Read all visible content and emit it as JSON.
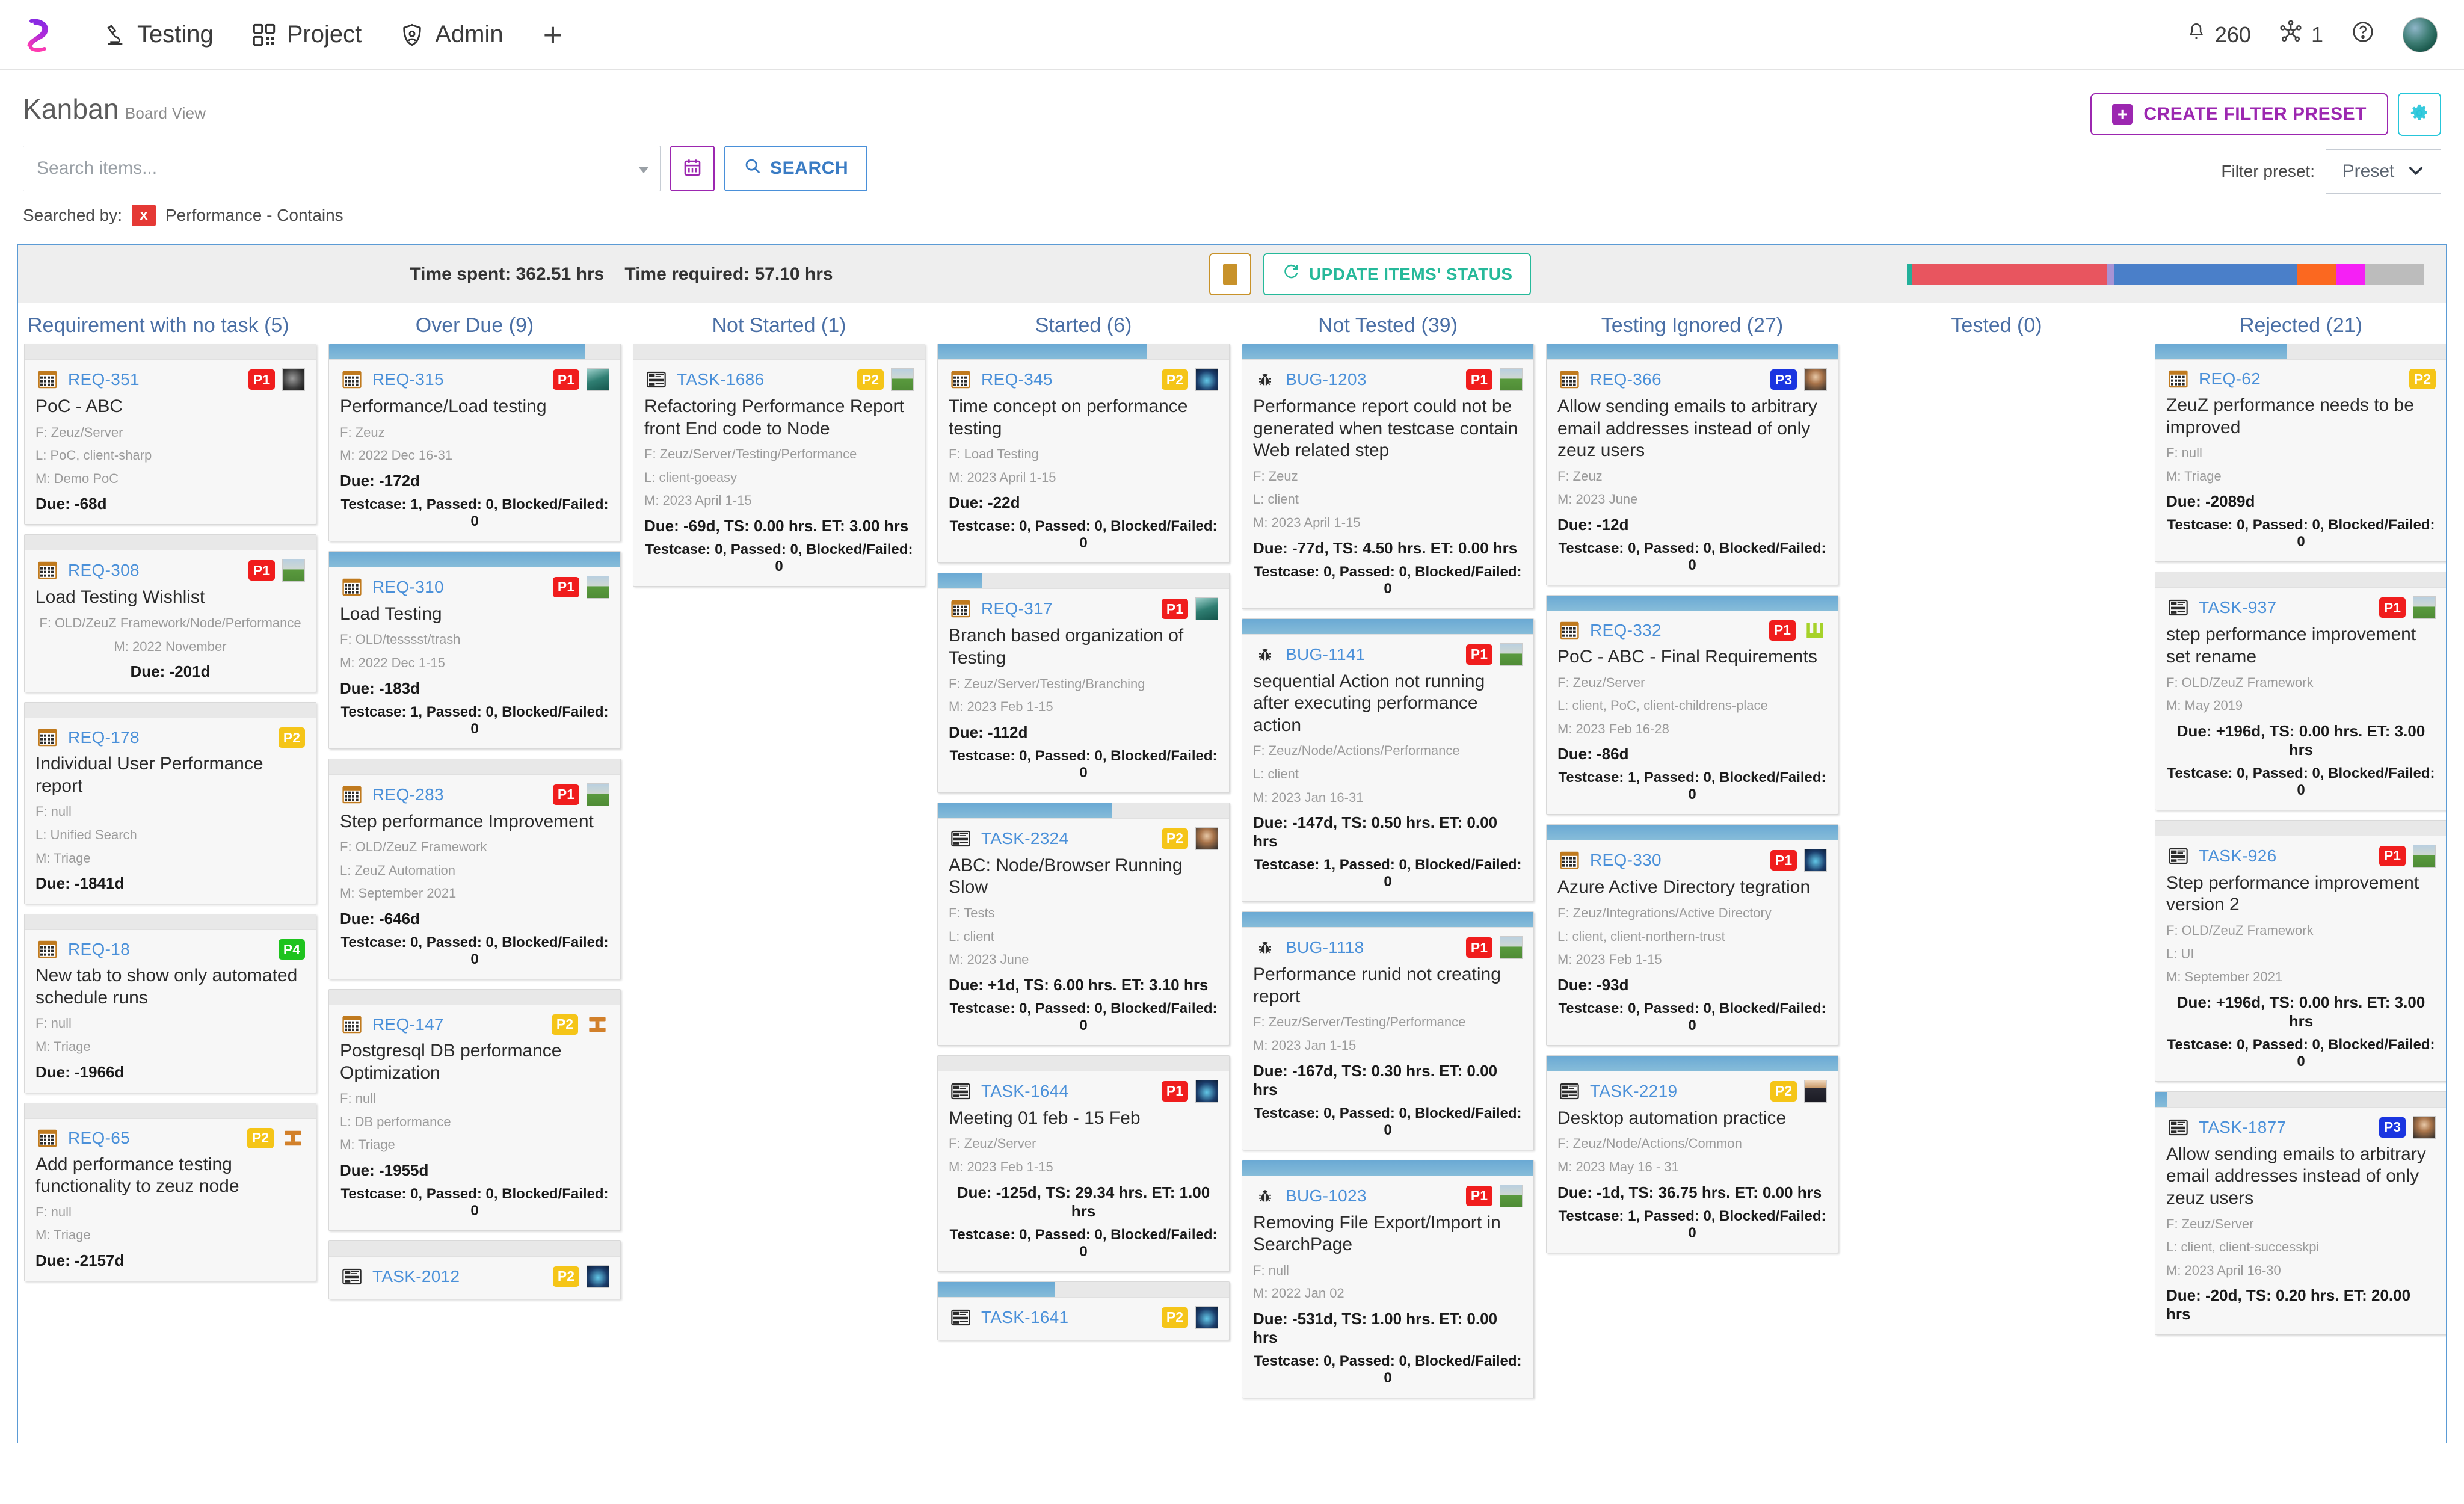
{
  "topnav": {
    "logo": "zeuz-logo",
    "items": [
      {
        "label": "Testing",
        "icon": "microscope-icon"
      },
      {
        "label": "Project",
        "icon": "grid-icon"
      },
      {
        "label": "Admin",
        "icon": "shield-user-icon"
      }
    ],
    "add_label": "+",
    "notifications_count": "260",
    "nodes_count": "1",
    "help_icon": "question-circle-icon",
    "avatar": "user-avatar"
  },
  "page": {
    "title": "Kanban",
    "subtitle": "Board View"
  },
  "search": {
    "placeholder": "Search items...",
    "value": "",
    "calendar_icon": "calendar-icon",
    "search_button": "SEARCH",
    "searched_by_label": "Searched by:",
    "chip_close": "x",
    "chip_text": "Performance - Contains"
  },
  "filters": {
    "create_preset": "CREATE FILTER PRESET",
    "gear_icon": "gear-icon",
    "preset_label": "Filter preset:",
    "preset_value": "Preset"
  },
  "stats": {
    "time_spent": "Time spent: 362.51 hrs",
    "time_required": "Time required: 57.10 hrs",
    "card_view_icon": "card-view-icon",
    "update_button": "UPDATE ITEMS' STATUS",
    "legend_segments": [
      {
        "color": "#22b09a",
        "pct": 1.1
      },
      {
        "color": "#e8555f",
        "pct": 37.5
      },
      {
        "color": "#a893d4",
        "pct": 1.4
      },
      {
        "color": "#4a7fc9",
        "pct": 35.5
      },
      {
        "color": "#fb6820",
        "pct": 7.5
      },
      {
        "color": "#f520f5",
        "pct": 5.5
      },
      {
        "color": "#bcbcbc",
        "pct": 11.5
      }
    ]
  },
  "columns": [
    {
      "title": "Requirement with no task  (5)",
      "cards": [
        {
          "type": "req",
          "id": "REQ-351",
          "bar": 0,
          "title": "PoC - ABC",
          "meta": [
            "F: Zeuz/Server",
            "L: PoC, client-sharp",
            "M: Demo PoC"
          ],
          "due": "Due: -68d",
          "tc": "",
          "priority": "P1",
          "thumb": "th-dark",
          "due_align": "left",
          "meta_align": "left"
        },
        {
          "type": "req",
          "id": "REQ-308",
          "bar": 0,
          "title": "Load Testing Wishlist",
          "meta": [
            "F: OLD/ZeuZ Framework/Node/Performance",
            "M: 2022 November"
          ],
          "due": "Due: -201d",
          "tc": "",
          "priority": "P1",
          "thumb": "th-field",
          "due_align": "center",
          "meta_align": "center"
        },
        {
          "type": "req",
          "id": "REQ-178",
          "bar": 0,
          "title": "Individual User Performance report",
          "meta": [
            "F: null",
            "L: Unified Search",
            "M: Triage"
          ],
          "due": "Due: -1841d",
          "tc": "",
          "priority": "P2",
          "thumb": "",
          "due_align": "left",
          "meta_align": "left"
        },
        {
          "type": "req",
          "id": "REQ-18",
          "bar": 0,
          "title": "New tab to show only automated schedule runs",
          "meta": [
            "F: null",
            "M: Triage"
          ],
          "due": "Due: -1966d",
          "tc": "",
          "priority": "P4",
          "thumb": "",
          "due_align": "left",
          "meta_align": "left"
        },
        {
          "type": "req",
          "id": "REQ-65",
          "bar": 0,
          "title": "Add performance testing functionality to zeuz node",
          "meta": [
            "F: null",
            "M: Triage"
          ],
          "due": "Due: -2157d",
          "tc": "",
          "priority": "P2",
          "thumb": "construct",
          "due_align": "left",
          "meta_align": "left"
        }
      ]
    },
    {
      "title": "Over Due  (9)",
      "cards": [
        {
          "type": "req",
          "id": "REQ-315",
          "bar": 88,
          "title": "Performance/Load testing",
          "meta": [
            "F: Zeuz",
            "M: 2022 Dec 16-31"
          ],
          "due": "Due: -172d",
          "tc": "Testcase: 1, Passed: 0, Blocked/Failed: 0",
          "priority": "P1",
          "thumb": "th-green",
          "due_align": "left",
          "meta_align": "left"
        },
        {
          "type": "req",
          "id": "REQ-310",
          "bar": 100,
          "title": "Load Testing",
          "meta": [
            "F: OLD/tesssst/trash",
            "M: 2022 Dec 1-15"
          ],
          "due": "Due: -183d",
          "tc": "Testcase: 1, Passed: 0, Blocked/Failed: 0",
          "priority": "P1",
          "thumb": "th-field",
          "due_align": "left",
          "meta_align": "left"
        },
        {
          "type": "req",
          "id": "REQ-283",
          "bar": 0,
          "title": "Step performance Improvement",
          "meta": [
            "F: OLD/ZeuZ Framework",
            "L: ZeuZ Automation",
            "M: September 2021"
          ],
          "due": "Due: -646d",
          "tc": "Testcase: 0, Passed: 0, Blocked/Failed: 0",
          "priority": "P1",
          "thumb": "th-field",
          "due_align": "left",
          "meta_align": "left"
        },
        {
          "type": "req",
          "id": "REQ-147",
          "bar": 0,
          "title": "Postgresql DB performance Optimization",
          "meta": [
            "F: null",
            "L: DB performance",
            "M: Triage"
          ],
          "due": "Due: -1955d",
          "tc": "Testcase: 0, Passed: 0, Blocked/Failed: 0",
          "priority": "P2",
          "thumb": "construct",
          "due_align": "left",
          "meta_align": "left"
        },
        {
          "type": "task",
          "id": "TASK-2012",
          "bar": 0,
          "title": "",
          "meta": [],
          "due": "",
          "tc": "",
          "priority": "P2",
          "thumb": "th-blue",
          "due_align": "left",
          "meta_align": "left"
        }
      ]
    },
    {
      "title": "Not Started  (1)",
      "cards": [
        {
          "type": "task",
          "id": "TASK-1686",
          "bar": 0,
          "title": "Refactoring Performance Report front End code to Node",
          "meta": [
            "F: Zeuz/Server/Testing/Performance",
            "L: client-goeasy",
            "M: 2023 April 1-15"
          ],
          "due": "Due: -69d, TS: 0.00 hrs. ET: 3.00 hrs",
          "tc": "Testcase: 0, Passed: 0, Blocked/Failed: 0",
          "priority": "P2",
          "thumb": "th-field",
          "due_align": "left",
          "meta_align": "left"
        }
      ]
    },
    {
      "title": "Started  (6)",
      "cards": [
        {
          "type": "req",
          "id": "REQ-345",
          "bar": 72,
          "title": "Time concept on performance testing",
          "meta": [
            "F: Load Testing",
            "M: 2023 April 1-15"
          ],
          "due": "Due: -22d",
          "tc": "Testcase: 0, Passed: 0, Blocked/Failed: 0",
          "priority": "P2",
          "thumb": "th-blue",
          "due_align": "left",
          "meta_align": "left"
        },
        {
          "type": "req",
          "id": "REQ-317",
          "bar": 15,
          "title": "Branch based organization of Testing",
          "meta": [
            "F: Zeuz/Server/Testing/Branching",
            "M: 2023 Feb 1-15"
          ],
          "due": "Due: -112d",
          "tc": "Testcase: 0, Passed: 0, Blocked/Failed: 0",
          "priority": "P1",
          "thumb": "th-green",
          "due_align": "left",
          "meta_align": "left"
        },
        {
          "type": "task",
          "id": "TASK-2324",
          "bar": 60,
          "title": "ABC: Node/Browser Running Slow",
          "meta": [
            "F: Tests",
            "L: client",
            "M: 2023 June"
          ],
          "due": "Due: +1d, TS: 6.00 hrs. ET: 3.10 hrs",
          "tc": "Testcase: 0, Passed: 0, Blocked/Failed: 0",
          "priority": "P2",
          "thumb": "th-person",
          "due_align": "left",
          "meta_align": "left"
        },
        {
          "type": "task",
          "id": "TASK-1644",
          "bar": 0,
          "title": "Meeting 01 feb - 15 Feb",
          "meta": [
            "F: Zeuz/Server",
            "M: 2023 Feb 1-15"
          ],
          "due": "Due: -125d, TS: 29.34 hrs. ET: 1.00 hrs",
          "tc": "Testcase: 0, Passed: 0, Blocked/Failed: 0",
          "priority": "P1",
          "thumb": "th-blue",
          "due_align": "center",
          "meta_align": "left"
        },
        {
          "type": "task",
          "id": "TASK-1641",
          "bar": 40,
          "title": "",
          "meta": [],
          "due": "",
          "tc": "",
          "priority": "P2",
          "thumb": "th-blue",
          "due_align": "left",
          "meta_align": "left"
        }
      ]
    },
    {
      "title": "Not Tested  (39)",
      "cards": [
        {
          "type": "bug",
          "id": "BUG-1203",
          "bar": 100,
          "title": "Performance report could not be generated when testcase contain Web related step",
          "meta": [
            "F: Zeuz",
            "L: client",
            "M: 2023 April 1-15"
          ],
          "due": "Due: -77d, TS: 4.50 hrs. ET: 0.00 hrs",
          "tc": "Testcase: 0, Passed: 0, Blocked/Failed: 0",
          "priority": "P1",
          "thumb": "th-field",
          "due_align": "left",
          "meta_align": "left"
        },
        {
          "type": "bug",
          "id": "BUG-1141",
          "bar": 100,
          "title": "sequential Action not running after executing performance action",
          "meta": [
            "F: Zeuz/Node/Actions/Performance",
            "L: client",
            "M: 2023 Jan 16-31"
          ],
          "due": "Due: -147d, TS: 0.50 hrs. ET: 0.00 hrs",
          "tc": "Testcase: 1, Passed: 0, Blocked/Failed: 0",
          "priority": "P1",
          "thumb": "th-field",
          "due_align": "left",
          "meta_align": "left"
        },
        {
          "type": "bug",
          "id": "BUG-1118",
          "bar": 100,
          "title": "Performance runid not creating report",
          "meta": [
            "F: Zeuz/Server/Testing/Performance",
            "M: 2023 Jan 1-15"
          ],
          "due": "Due: -167d, TS: 0.30 hrs. ET: 0.00 hrs",
          "tc": "Testcase: 0, Passed: 0, Blocked/Failed: 0",
          "priority": "P1",
          "thumb": "th-field",
          "due_align": "left",
          "meta_align": "left"
        },
        {
          "type": "bug",
          "id": "BUG-1023",
          "bar": 100,
          "title": "Removing File Export/Import in SearchPage",
          "meta": [
            "F: null",
            "M: 2022 Jan 02"
          ],
          "due": "Due: -531d, TS: 1.00 hrs. ET: 0.00 hrs",
          "tc": "Testcase: 0, Passed: 0, Blocked/Failed: 0",
          "priority": "P1",
          "thumb": "th-field",
          "due_align": "left",
          "meta_align": "left"
        }
      ]
    },
    {
      "title": "Testing Ignored  (27)",
      "cards": [
        {
          "type": "req",
          "id": "REQ-366",
          "bar": 100,
          "title": "Allow sending emails to arbitrary email addresses instead of only zeuz users",
          "meta": [
            "F: Zeuz",
            "M: 2023 June"
          ],
          "due": "Due: -12d",
          "tc": "Testcase: 0, Passed: 0, Blocked/Failed: 0",
          "priority": "P3",
          "thumb": "th-person",
          "due_align": "left",
          "meta_align": "left"
        },
        {
          "type": "req",
          "id": "REQ-332",
          "bar": 100,
          "title": "PoC - ABC - Final Requirements",
          "meta": [
            "F: Zeuz/Server",
            "L: client, PoC, client-childrens-place",
            "M: 2023 Feb 16-28"
          ],
          "due": "Due: -86d",
          "tc": "Testcase: 1, Passed: 0, Blocked/Failed: 0",
          "priority": "P1",
          "thumb": "th-ui",
          "due_align": "left",
          "meta_align": "left"
        },
        {
          "type": "req",
          "id": "REQ-330",
          "bar": 100,
          "title": "Azure Active Directory tegration",
          "meta": [
            "F: Zeuz/Integrations/Active Directory",
            "L: client, client-northern-trust",
            "M: 2023 Feb 1-15"
          ],
          "due": "Due: -93d",
          "tc": "Testcase: 0, Passed: 0, Blocked/Failed: 0",
          "priority": "P1",
          "thumb": "th-blue",
          "due_align": "left",
          "meta_align": "left"
        },
        {
          "type": "task",
          "id": "TASK-2219",
          "bar": 100,
          "title": "Desktop automation practice",
          "meta": [
            "F: Zeuz/Node/Actions/Common",
            "M: 2023 May 16 - 31"
          ],
          "due": "Due: -1d, TS: 36.75 hrs. ET: 0.00 hrs",
          "tc": "Testcase: 1, Passed: 0, Blocked/Failed: 0",
          "priority": "P2",
          "thumb": "th-suit",
          "due_align": "left",
          "meta_align": "left"
        }
      ]
    },
    {
      "title": "Tested  (0)",
      "cards": []
    },
    {
      "title": "Rejected  (21)",
      "cards": [
        {
          "type": "req",
          "id": "REQ-62",
          "bar": 45,
          "title": "ZeuZ performance needs to be improved",
          "meta": [
            "F: null",
            "M: Triage"
          ],
          "due": "Due: -2089d",
          "tc": "Testcase: 0, Passed: 0, Blocked/Failed: 0",
          "priority": "P2",
          "thumb": "",
          "due_align": "left",
          "meta_align": "left"
        },
        {
          "type": "task",
          "id": "TASK-937",
          "bar": 0,
          "title": "step performance improvement set rename",
          "meta": [
            "F: OLD/ZeuZ Framework",
            "M: May 2019"
          ],
          "due": "Due: +196d, TS: 0.00 hrs. ET: 3.00 hrs",
          "tc": "Testcase: 0, Passed: 0, Blocked/Failed: 0",
          "priority": "P1",
          "thumb": "th-field",
          "due_align": "center",
          "meta_align": "left"
        },
        {
          "type": "task",
          "id": "TASK-926",
          "bar": 0,
          "title": "Step performance improvement version 2",
          "meta": [
            "F: OLD/ZeuZ Framework",
            "L: UI",
            "M: September 2021"
          ],
          "due": "Due: +196d, TS: 0.00 hrs. ET: 3.00 hrs",
          "tc": "Testcase: 0, Passed: 0, Blocked/Failed: 0",
          "priority": "P1",
          "thumb": "th-field",
          "due_align": "center",
          "meta_align": "left"
        },
        {
          "type": "task",
          "id": "TASK-1877",
          "bar": 4,
          "title": "Allow sending emails to arbitrary email addresses instead of only zeuz users",
          "meta": [
            "F: Zeuz/Server",
            "L: client, client-successkpi",
            "M: 2023 April 16-30"
          ],
          "due": "Due: -20d, TS: 0.20 hrs. ET: 20.00 hrs",
          "tc": "",
          "priority": "P3",
          "thumb": "th-person",
          "due_align": "left",
          "meta_align": "left"
        }
      ]
    }
  ]
}
